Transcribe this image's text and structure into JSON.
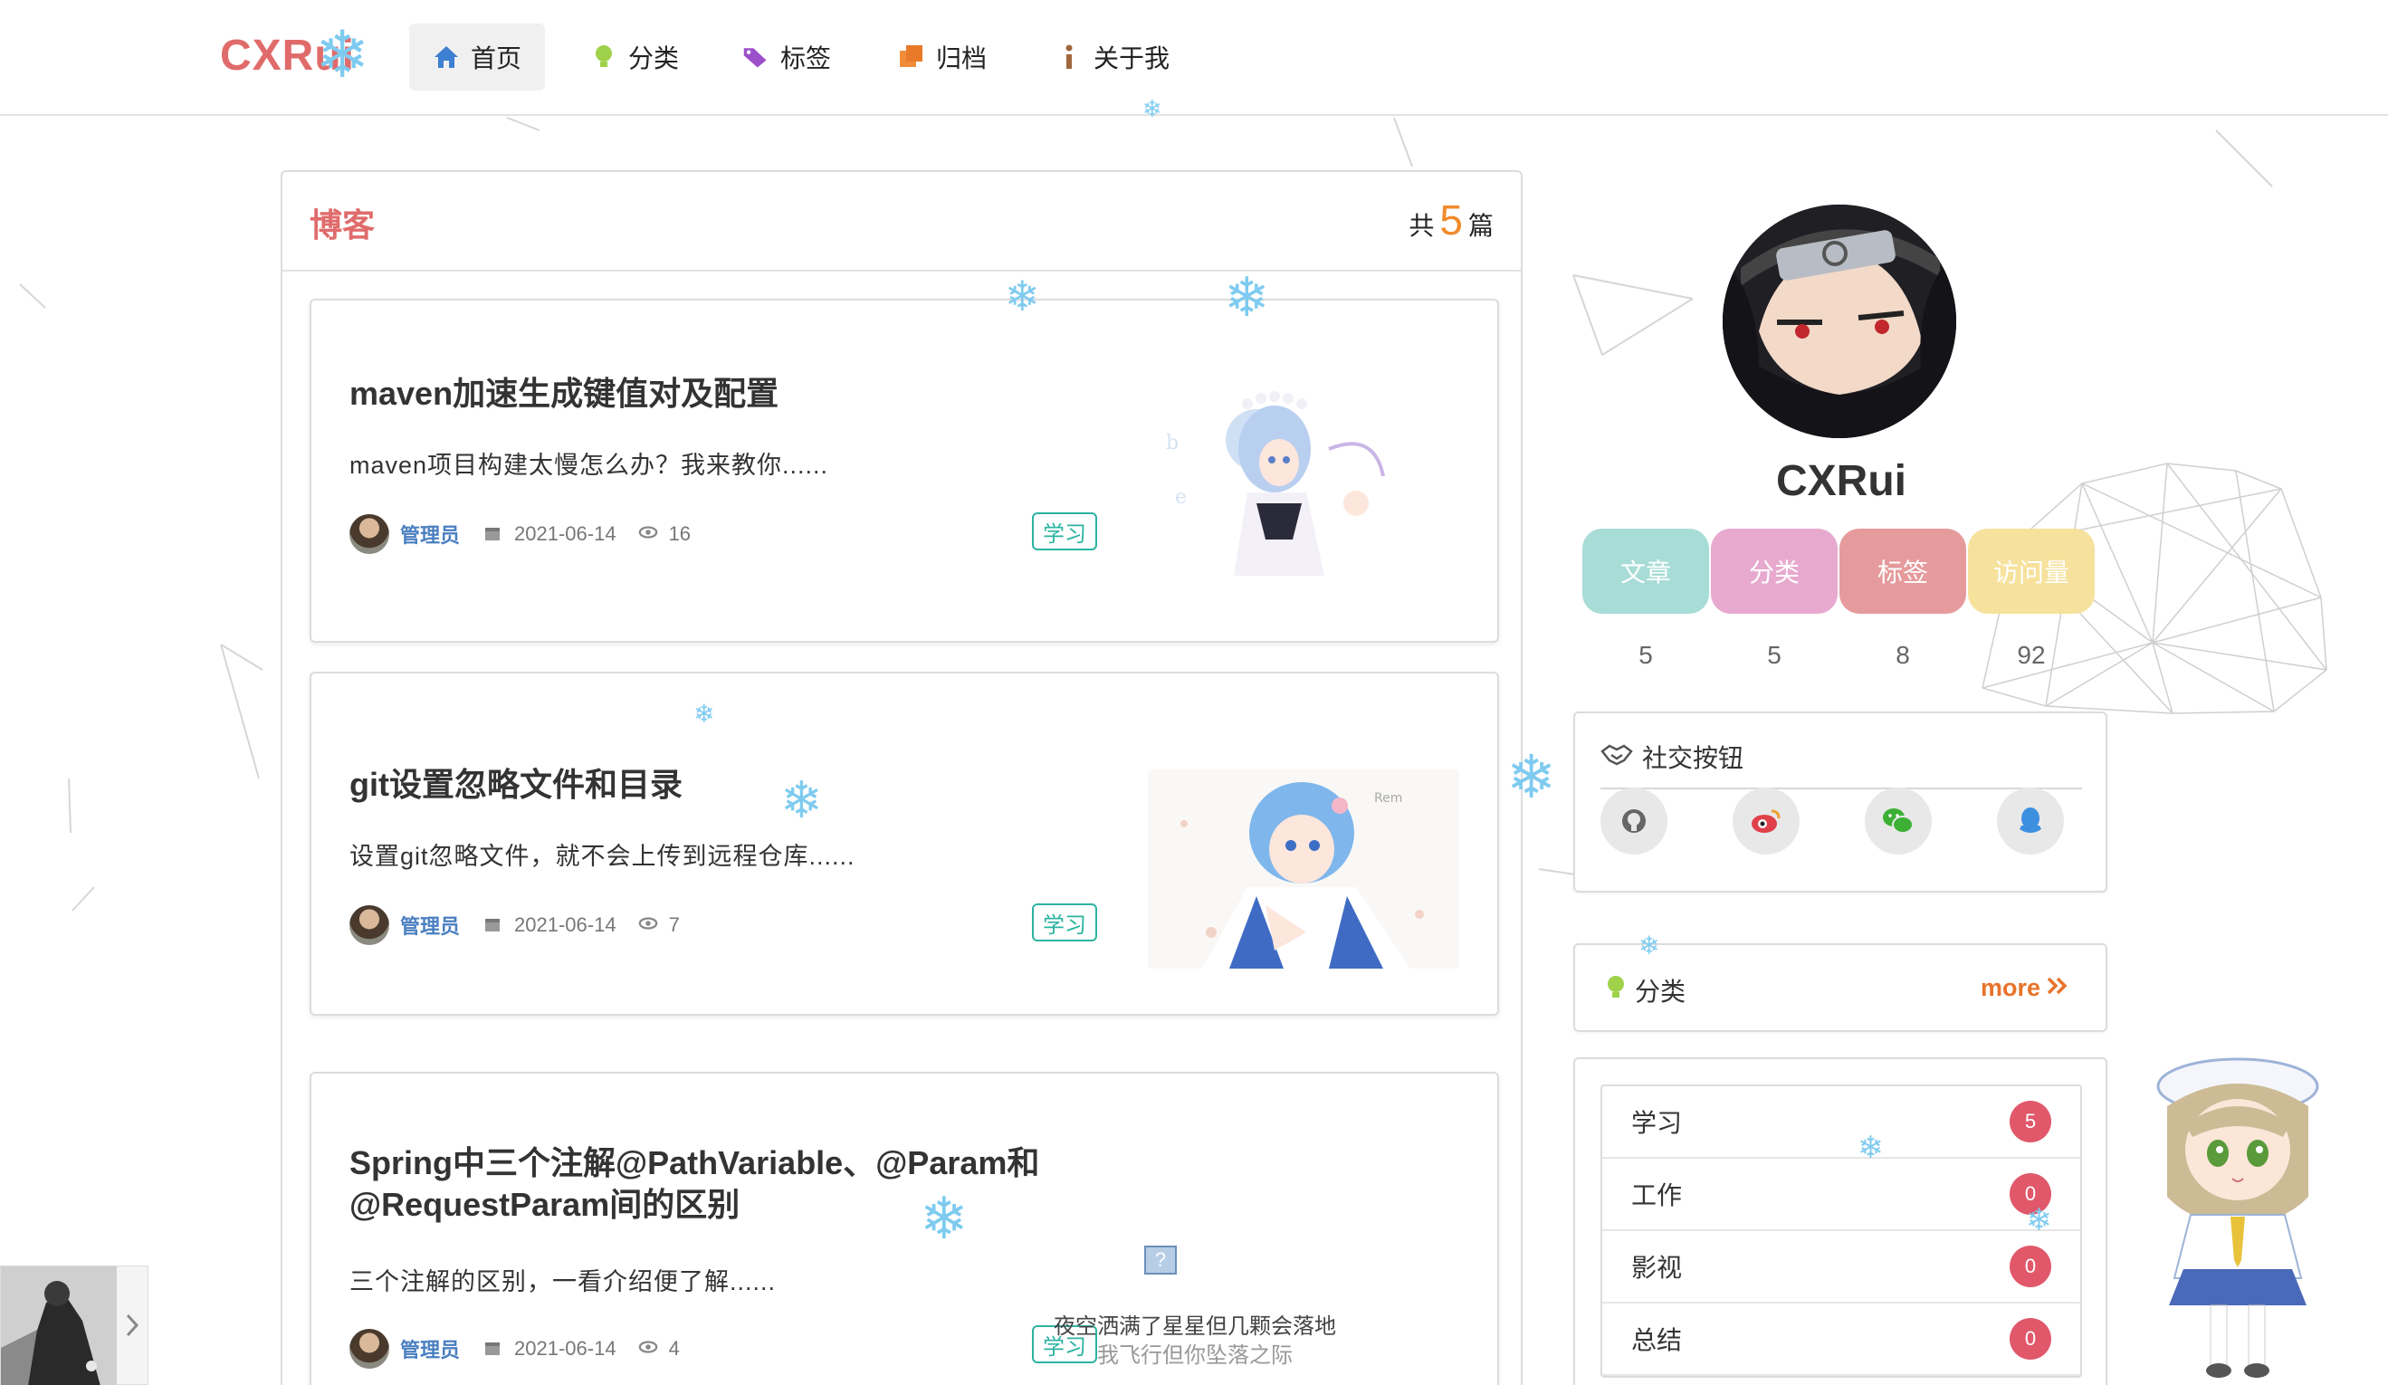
{
  "nav": {
    "logo": "CXRui",
    "items": [
      {
        "label": "首页",
        "icon": "home-icon",
        "active": true
      },
      {
        "label": "分类",
        "icon": "lightbulb-icon"
      },
      {
        "label": "标签",
        "icon": "tags-icon"
      },
      {
        "label": "归档",
        "icon": "clone-icon"
      },
      {
        "label": "关于我",
        "icon": "info-icon"
      }
    ]
  },
  "blog": {
    "title": "博客",
    "count_prefix": "共",
    "count": "5",
    "count_suffix": "篇",
    "posts": [
      {
        "title": "maven加速生成键值对及配置",
        "excerpt": "maven项目构建太慢怎么办？我来教你......",
        "author": "管理员",
        "date": "2021-06-14",
        "views": "16",
        "tag": "学习"
      },
      {
        "title": "git设置忽略文件和目录",
        "excerpt": "设置git忽略文件，就不会上传到远程仓库......",
        "author": "管理员",
        "date": "2021-06-14",
        "views": "7",
        "tag": "学习"
      },
      {
        "title_line1": "Spring中三个注解@PathVariable、@Param和",
        "title_line2": "@RequestParam间的区别",
        "excerpt": "三个注解的区别，一看介绍便了解......",
        "author": "管理员",
        "date": "2021-06-14",
        "views": "4",
        "tag": "学习"
      }
    ]
  },
  "profile": {
    "name": "CXRui",
    "stats": [
      {
        "label": "文章",
        "value": "5",
        "color": "#a8dcd6"
      },
      {
        "label": "分类",
        "value": "5",
        "color": "#e8a9cf"
      },
      {
        "label": "标签",
        "value": "8",
        "color": "#e59a9c"
      },
      {
        "label": "访问量",
        "value": "92",
        "color": "#f6e29c"
      }
    ]
  },
  "social": {
    "title": "社交按钮",
    "icons": [
      "github-icon",
      "weibo-icon",
      "wechat-icon",
      "qq-icon"
    ]
  },
  "categories": {
    "title": "分类",
    "more": "more",
    "items": [
      {
        "name": "学习",
        "count": "5"
      },
      {
        "name": "工作",
        "count": "0"
      },
      {
        "name": "影视",
        "count": "0"
      },
      {
        "name": "总结",
        "count": "0"
      }
    ]
  },
  "player": {
    "lyric_line1": "夜空洒满了星星但几颗会落地",
    "lyric_line2": "我飞行但你坠落之际",
    "missing_image": "?"
  }
}
